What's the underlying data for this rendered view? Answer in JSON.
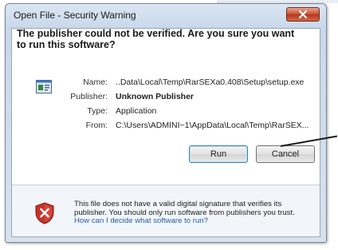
{
  "window": {
    "title": "Open File - Security Warning"
  },
  "heading": "The publisher could not be verified.  Are you sure you want to run this software?",
  "details": [
    {
      "label": "Name:",
      "value": "..Data\\Local\\Temp\\RarSEXa0.408\\Setup\\setup.exe"
    },
    {
      "label": "Publisher:",
      "value": "Unknown Publisher"
    },
    {
      "label": "Type:",
      "value": "Application"
    },
    {
      "label": "From:",
      "value": "C:\\Users\\ADMINI~1\\AppData\\Local\\Temp\\RarSEX..."
    }
  ],
  "buttons": {
    "run": "Run",
    "cancel": "Cancel"
  },
  "warning": {
    "text": "This file does not have a valid digital signature that verifies its publisher.  You should only run software from publishers you trust.",
    "link": "How can I decide what software to run?"
  },
  "colors": {
    "link": "#1f5fb0",
    "close_button": "#c84b2e",
    "shield_red": "#c8322a"
  },
  "icons": [
    "file-icon",
    "close-icon",
    "shield-warning-icon"
  ]
}
